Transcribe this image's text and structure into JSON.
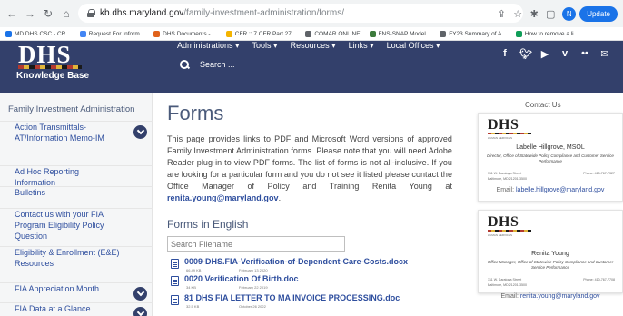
{
  "browser": {
    "url_host": "kb.dhs.maryland.gov",
    "url_path": "/family-investment-administration/forms/",
    "profile_initial": "N",
    "update_label": "Update",
    "bookmarks": [
      {
        "label": "MD DHS CSC - CR...",
        "color": "#1a73e8"
      },
      {
        "label": "Request For Inform...",
        "color": "#4285f4"
      },
      {
        "label": "DHS Documents - ...",
        "color": "#e0621a"
      },
      {
        "label": "CFR :: 7 CFR Part 27...",
        "color": "#f4b400"
      },
      {
        "label": "COMAR ONLINE",
        "color": "#5f6368"
      },
      {
        "label": "FNS-SNAP Model...",
        "color": "#3c7a3c"
      },
      {
        "label": "FY23 Summary of A...",
        "color": "#5f6368"
      },
      {
        "label": "How to remove a li...",
        "color": "#0f9d58"
      }
    ]
  },
  "site": {
    "logo_text": "DHS",
    "logo_subtitle": "Knowledge Base",
    "nav": [
      "Administrations ▾",
      "Tools ▾",
      "Resources ▾",
      "Links ▾",
      "Local Offices ▾"
    ],
    "search_placeholder": "Search ...",
    "social": [
      "f",
      "t",
      "yt",
      "v",
      "fl",
      "mail"
    ]
  },
  "sidebar": {
    "title": "Family Investment Administration",
    "items": [
      {
        "label": "Action Transmittals-AT/Information Memo-IM",
        "expandable": true
      },
      {
        "label": "Ad Hoc Reporting Information",
        "expandable": false
      },
      {
        "label": "Bulletins",
        "expandable": false
      },
      {
        "label": "Contact us with your FIA Program Eligibility Policy Question",
        "expandable": false
      },
      {
        "label": "Eligibility & Enrollment (E&E) Resources",
        "expandable": false
      },
      {
        "label": "FIA Appreciation Month",
        "expandable": true
      },
      {
        "label": "FIA Data at a Glance",
        "expandable": true
      }
    ]
  },
  "main": {
    "title": "Forms",
    "intro_text": "This page provides links to PDF and Microsoft Word versions of approved Family Investment Administration forms. Please note that you will need Adobe Reader plug-in to view PDF forms. The list of forms is not all-inclusive. If you are looking for a particular form and you do not see it listed please contact the Office Manager of Policy and Training Renita Young at ",
    "intro_email": "renita.young@maryland.gov",
    "intro_end": ".",
    "subtitle": "Forms in English",
    "filter_placeholder": "Search Filename",
    "documents": [
      {
        "name": "0009-DHS.FIA-Verification-of-Dependent-Care-Costs.docx",
        "size": "66.49 KB",
        "date": "February 13 2020"
      },
      {
        "name": "0020 Verification Of Birth.doc",
        "size": "34 KB",
        "date": "February 22 2019"
      },
      {
        "name": "81 DHS FIA LETTER TO MA INVOICE PROCESSING.doc",
        "size": "32.5 KB",
        "date": "October 26 2022"
      }
    ]
  },
  "contact": {
    "heading": "Contact Us",
    "cards": [
      {
        "logo": "DHS",
        "logo_tag": "HUMAN SERVICES",
        "name": "Labelle Hillgrove, MSOL",
        "role": "Director, Office of Statewide Policy Compliance and Customer Service Performance",
        "address_1": "311 W. Saratoga Street",
        "address_2": "Baltimore, MD 21201-3500",
        "phone": "Phone: 410-767-7327",
        "email_label": "Email:",
        "email": "labelle.hillgrove@maryland.gov"
      },
      {
        "logo": "DHS",
        "logo_tag": "HUMAN SERVICES",
        "name": "Renita Young",
        "role": "Office Manager, Office of Statewide Policy Compliance and Customer Service Performance",
        "address_1": "311 W. Saratoga Street",
        "address_2": "Baltimore, MD 21201-3500",
        "phone": "Phone: 410-767-7708",
        "email_label": "Email:",
        "email": "renita.young@maryland.gov"
      }
    ]
  },
  "colors": {
    "header_bg": "#33406b",
    "link": "#2e4e9e",
    "heading": "#4a5a7a"
  }
}
